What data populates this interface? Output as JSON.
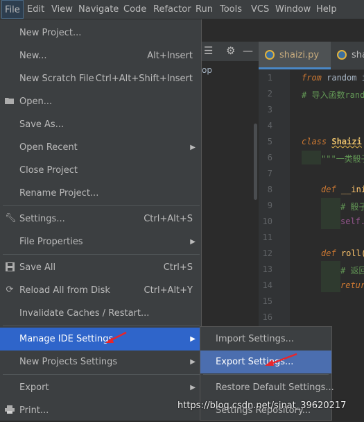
{
  "menubar": {
    "items": [
      "File",
      "Edit",
      "View",
      "Navigate",
      "Code",
      "Refactor",
      "Run",
      "Tools",
      "VCS",
      "Window",
      "Help"
    ]
  },
  "background": {
    "project_fragment": "op",
    "tabs": [
      {
        "label": "shaizi.py",
        "active": true
      },
      {
        "label": "shai",
        "active": false
      }
    ],
    "line_numbers": [
      "1",
      "2",
      "3",
      "4",
      "5",
      "6",
      "7",
      "8",
      "9",
      "10",
      "11",
      "12",
      "13",
      "14",
      "15",
      "16"
    ],
    "code": {
      "l1_kw": "from",
      "l1_rest": " random i",
      "l2": "# 导入函数rand",
      "l5_kw": "class",
      "l5_name": "Shaizi",
      "l6": "\"\"\"一类骰子",
      "l7_kw": "def",
      "l7_fn": "__ini",
      "l9": "# 骰子",
      "l10": "self.",
      "l12_kw": "def",
      "l12_fn": "roll(",
      "l13": "# 返回",
      "l14": "retur"
    }
  },
  "file_menu": {
    "items": [
      {
        "label": "New Project...",
        "shortcut": ""
      },
      {
        "label": "New...",
        "shortcut": "Alt+Insert"
      },
      {
        "label": "New Scratch File",
        "shortcut": "Ctrl+Alt+Shift+Insert"
      },
      {
        "label": "Open...",
        "shortcut": ""
      },
      {
        "label": "Save As...",
        "shortcut": ""
      },
      {
        "label": "Open Recent",
        "shortcut": ""
      },
      {
        "label": "Close Project",
        "shortcut": ""
      },
      {
        "label": "Rename Project...",
        "shortcut": ""
      },
      {
        "label": "Settings...",
        "shortcut": "Ctrl+Alt+S"
      },
      {
        "label": "File Properties",
        "shortcut": ""
      },
      {
        "label": "Save All",
        "shortcut": "Ctrl+S"
      },
      {
        "label": "Reload All from Disk",
        "shortcut": "Ctrl+Alt+Y"
      },
      {
        "label": "Invalidate Caches / Restart...",
        "shortcut": ""
      },
      {
        "label": "Manage IDE Settings",
        "shortcut": ""
      },
      {
        "label": "New Projects Settings",
        "shortcut": ""
      },
      {
        "label": "Export",
        "shortcut": ""
      },
      {
        "label": "Print...",
        "shortcut": ""
      }
    ]
  },
  "submenu": {
    "items": [
      "Import Settings...",
      "Export Settings...",
      "Restore Default Settings...",
      "Settings Repository..."
    ]
  },
  "watermark": "https://blog.csdn.net/sinat_39620217",
  "colors": {
    "menu_bg": "#3c3f41",
    "highlight": "#4b6eaf",
    "annotation_arrow": "#e8262b"
  }
}
